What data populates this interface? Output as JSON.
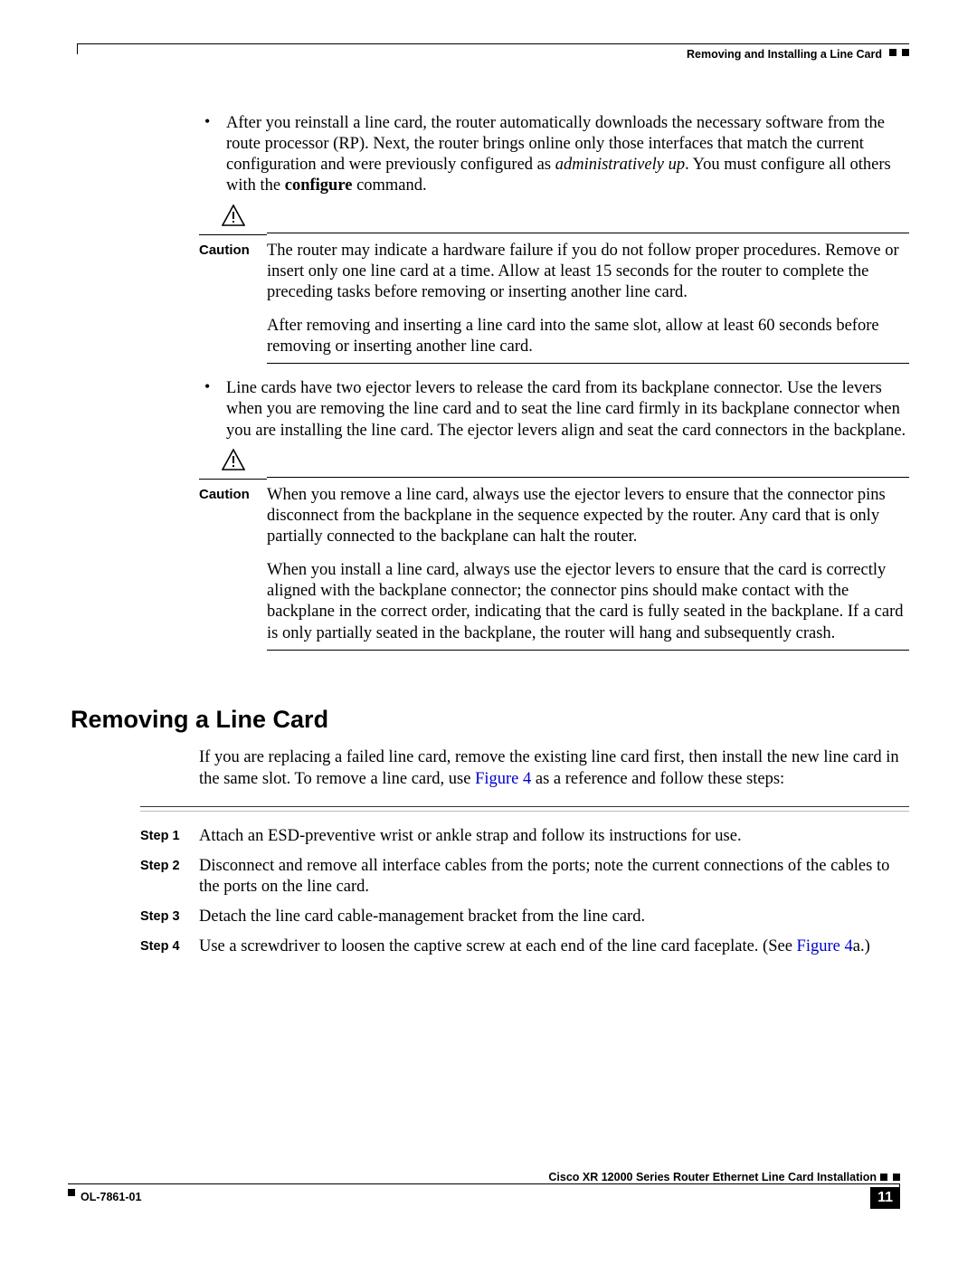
{
  "header": {
    "running_title": "Removing and Installing a Line Card"
  },
  "bullets": {
    "b1_pre": "After you reinstall a line card, the router automatically downloads the necessary software from the route processor (RP). Next, the router brings online only those interfaces that match the current configuration and were previously configured as ",
    "b1_ital": "administratively up",
    "b1_mid": ". You must configure all others with the ",
    "b1_bold": "configure",
    "b1_post": " command.",
    "b2": "Line cards have two ejector levers to release the card from its backplane connector. Use the levers when you are removing the line card and to seat the line card firmly in its backplane connector when you are installing the line card. The ejector levers align and seat the card connectors in the backplane."
  },
  "caution1": {
    "label": "Caution",
    "p1": "The router may indicate a hardware failure if you do not follow proper procedures. Remove or insert only one line card at a time. Allow at least 15 seconds for the router to complete the preceding tasks before removing or inserting another line card.",
    "p2": "After removing and inserting a line card into the same slot, allow at least 60 seconds before removing or inserting another line card."
  },
  "caution2": {
    "label": "Caution",
    "p1": "When you remove a line card, always use the ejector levers to ensure that the connector pins disconnect from the backplane in the sequence expected by the router. Any card that is only partially connected to the backplane can halt the router.",
    "p2": "When you install a line card, always use the ejector levers to ensure that the card is correctly aligned with the backplane connector; the connector pins should make contact with the backplane in the correct order, indicating that the card is fully seated in the backplane. If a card is only partially seated in the backplane, the router will hang and subsequently crash."
  },
  "section": {
    "heading": "Removing a Line Card",
    "intro_pre": "If you are replacing a failed line card, remove the existing line card first, then install the new line card in the same slot. To remove a line card, use ",
    "intro_link": "Figure 4",
    "intro_post": " as a reference and follow these steps:"
  },
  "steps": [
    {
      "label": "Step 1",
      "text": "Attach an ESD-preventive wrist or ankle strap and follow its instructions for use."
    },
    {
      "label": "Step 2",
      "text": "Disconnect and remove all interface cables from the ports; note the current connections of the cables to the ports on the line card."
    },
    {
      "label": "Step 3",
      "text": "Detach the line card cable-management bracket from the line card."
    },
    {
      "label": "Step 4",
      "text_pre": "Use a screwdriver to loosen the captive screw at each end of the line card faceplate. (See ",
      "link": "Figure 4",
      "text_post": "a.)"
    }
  ],
  "footer": {
    "doc_title": "Cisco XR 12000 Series Router Ethernet Line Card Installation",
    "doc_code": "OL-7861-01",
    "page": "11"
  }
}
